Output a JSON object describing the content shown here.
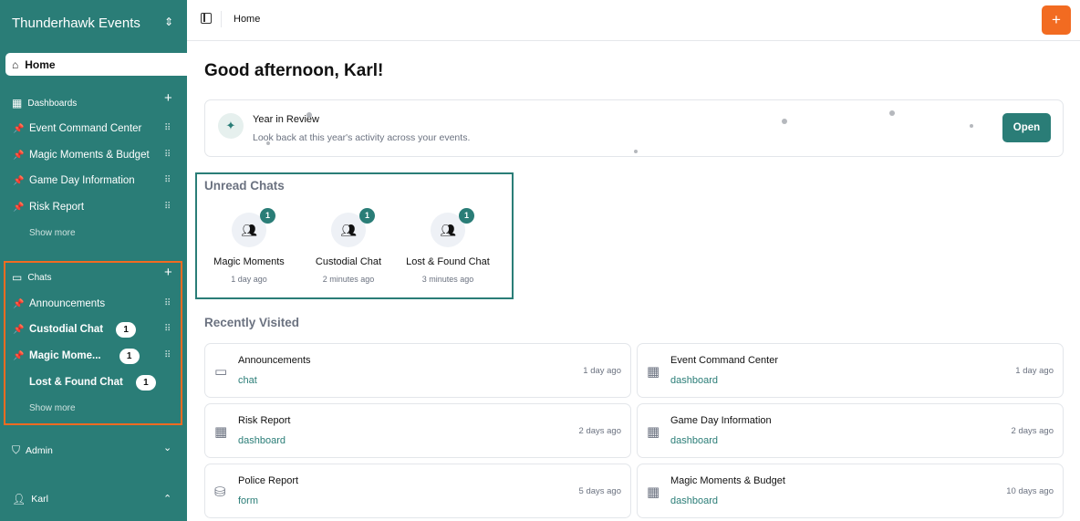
{
  "sidebar": {
    "org_name": "Thunderhawk Events",
    "home": "Home",
    "dashboards": {
      "label": "Dashboards",
      "items": [
        "Event Command Center",
        "Magic Moments & Budget",
        "Game Day Information",
        "Risk Report"
      ],
      "show_more": "Show more"
    },
    "chats": {
      "label": "Chats",
      "items": [
        {
          "label": "Announcements",
          "pinned": true
        },
        {
          "label": "Custodial Chat",
          "pinned": true,
          "unread": "1"
        },
        {
          "label": "Magic Mome...",
          "pinned": true,
          "unread": "1"
        },
        {
          "label": "Lost & Found Chat",
          "pinned": false,
          "unread": "1"
        }
      ],
      "show_more": "Show more"
    },
    "admin": "Admin",
    "user": "Karl"
  },
  "topbar": {
    "breadcrumb": "Home",
    "add_icon": "plus-icon"
  },
  "main": {
    "greeting": "Good afternoon, Karl!",
    "year_review": {
      "title": "Year in Review",
      "subtitle": "Look back at this year's activity across your events.",
      "button": "Open"
    },
    "unread": {
      "title": "Unread Chats",
      "items": [
        {
          "name": "Magic Moments",
          "count": "1",
          "time": "1 day ago"
        },
        {
          "name": "Custodial Chat",
          "count": "1",
          "time": "2 minutes ago"
        },
        {
          "name": "Lost & Found Chat",
          "count": "1",
          "time": "3 minutes ago"
        }
      ]
    },
    "recent": {
      "title": "Recently Visited",
      "items": [
        {
          "name": "Announcements",
          "kind": "chat",
          "time": "1 day ago"
        },
        {
          "name": "Event Command Center",
          "kind": "dashboard",
          "time": "1 day ago"
        },
        {
          "name": "Risk Report",
          "kind": "dashboard",
          "time": "2 days ago"
        },
        {
          "name": "Game Day Information",
          "kind": "dashboard",
          "time": "2 days ago"
        },
        {
          "name": "Police Report",
          "kind": "form",
          "time": "5 days ago"
        },
        {
          "name": "Magic Moments & Budget",
          "kind": "dashboard",
          "time": "10 days ago"
        }
      ]
    }
  },
  "colors": {
    "sidebar": "#2a7d77",
    "accent": "#f26b21",
    "highlight": "#2a7d77"
  }
}
